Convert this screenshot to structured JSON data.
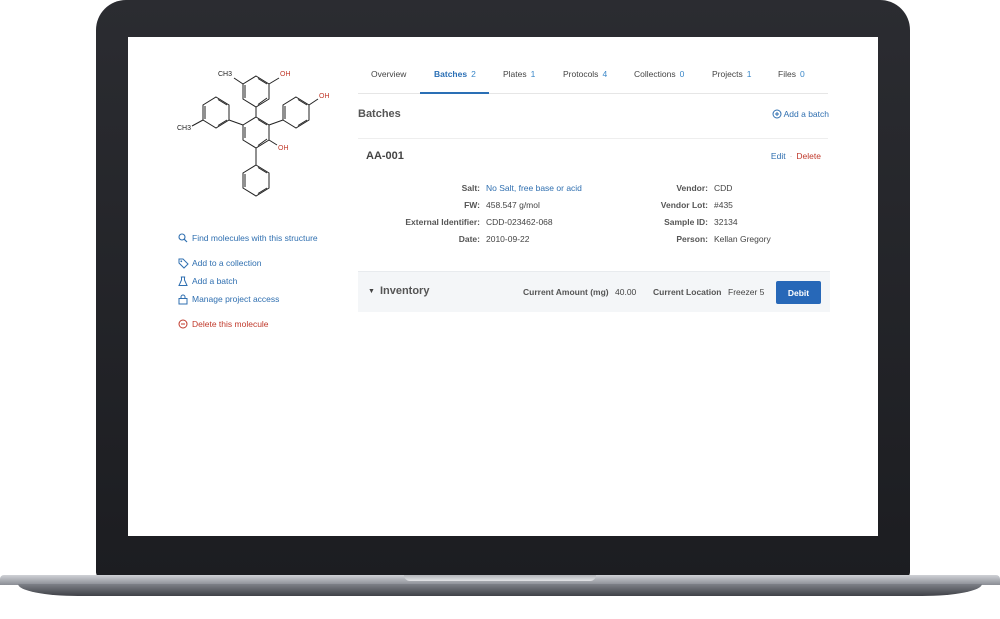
{
  "molecule": {
    "atom_labels": {
      "methyl_top": "CH3",
      "methyl_left": "CH3",
      "oh_top": "OH",
      "oh_right": "OH",
      "oh_center": "OH"
    }
  },
  "sidebar": {
    "find_label": "Find molecules with this structure",
    "add_collection_label": "Add to a collection",
    "add_batch_label": "Add a batch",
    "manage_access_label": "Manage project access",
    "delete_label": "Delete this molecule"
  },
  "tabs": [
    {
      "label": "Overview",
      "count": ""
    },
    {
      "label": "Batches",
      "count": "2"
    },
    {
      "label": "Plates",
      "count": "1"
    },
    {
      "label": "Protocols",
      "count": "4"
    },
    {
      "label": "Collections",
      "count": "0"
    },
    {
      "label": "Projects",
      "count": "1"
    },
    {
      "label": "Files",
      "count": "0"
    }
  ],
  "active_tab": "Batches",
  "batches": {
    "title": "Batches",
    "add_label": "Add a batch"
  },
  "batch": {
    "name": "AA-001",
    "edit_label": "Edit",
    "sep": "·",
    "delete_label": "Delete",
    "left_fields": [
      {
        "label": "Salt:",
        "value": "No Salt, free base or acid"
      },
      {
        "label": "FW:",
        "value": "458.547 g/mol"
      },
      {
        "label": "External Identifier:",
        "value": "CDD-023462-068"
      },
      {
        "label": "Date:",
        "value": "2010-09-22"
      }
    ],
    "right_fields": [
      {
        "label": "Vendor:",
        "value": "CDD"
      },
      {
        "label": "Vendor Lot:",
        "value": "#435"
      },
      {
        "label": "Sample ID:",
        "value": "32134"
      },
      {
        "label": "Person:",
        "value": "Kellan Gregory"
      }
    ]
  },
  "inventory": {
    "title": "Inventory",
    "amount_label": "Current Amount (mg)",
    "amount_value": "40.00",
    "location_label": "Current Location",
    "location_value": "Freezer 5",
    "debit_label": "Debit"
  },
  "colors": {
    "accent": "#2a6fb5",
    "danger": "#c0392b",
    "oxygen": "#c0392b"
  }
}
